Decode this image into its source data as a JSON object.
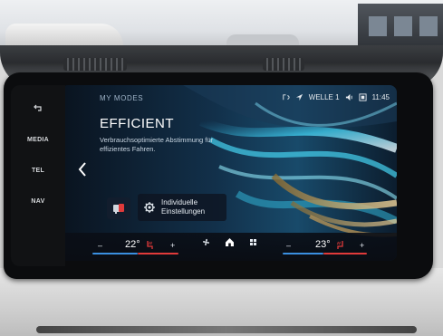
{
  "side_buttons": {
    "back_icon": "back-arrow-icon",
    "media": "MEDIA",
    "tel": "TEL",
    "nav": "NAV"
  },
  "status_bar": {
    "station": "WELLE 1",
    "time": "11:45",
    "icons": [
      "phone-signal-icon",
      "navigation-arrow-icon",
      "volume-icon",
      "screen-icon"
    ]
  },
  "mode": {
    "header": "MY MODES",
    "title": "EFFICIENT",
    "description": "Verbrauchsoptimierte Abstimmung für effizientes Fahren."
  },
  "settings_button": {
    "line1": "Individuelle",
    "line2": "Einstellungen"
  },
  "climate": {
    "left_temp": "22°",
    "right_temp": "23°",
    "minus": "–",
    "plus": "+",
    "heat_color": "#e03a3a",
    "cool_color": "#3a8fe0"
  },
  "colors": {
    "accent_cyan": "#39c8e6",
    "accent_gold": "#d9b36a"
  }
}
